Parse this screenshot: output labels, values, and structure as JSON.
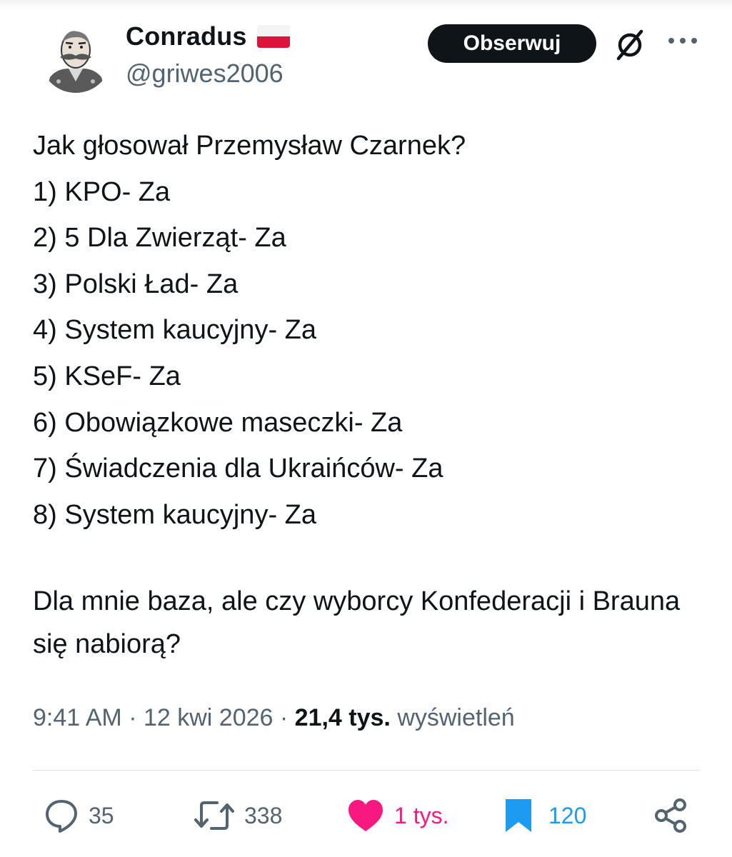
{
  "user": {
    "name": "Conradus",
    "handle": "@griwes2006"
  },
  "header": {
    "follow_label": "Obserwuj"
  },
  "tweet": {
    "lines": [
      "Jak głosował Przemysław Czarnek?",
      "1) KPO- Za",
      "2) 5 Dla Zwierząt- Za",
      "3) Polski Ład- Za",
      "4) System kaucyjny- Za",
      "5) KSeF- Za",
      "6) Obowiązkowe maseczki- Za",
      "7) Świadczenia dla Ukraińców- Za",
      "8) System kaucyjny- Za"
    ],
    "closing": "Dla mnie baza, ale czy wyborcy Konfederacji i Brauna się nabiorą?"
  },
  "meta": {
    "time": "9:41 AM",
    "sep1": " · ",
    "date": "12 kwi 2026",
    "sep2": " · ",
    "views_count": "21,4 tys.",
    "views_label": " wyświetleń"
  },
  "actions": {
    "replies": "35",
    "reposts": "338",
    "likes": "1 tys.",
    "bookmarks": "120"
  },
  "icons": {
    "reply": "reply-bubble-icon",
    "repost": "repost-icon",
    "like": "heart-icon",
    "bookmark": "bookmark-icon",
    "share": "share-icon",
    "grok": "grok-icon",
    "more": "more-dots-icon",
    "flag": "poland-flag-icon"
  },
  "colors": {
    "like": "#f91880",
    "bookmark": "#1d9bf0",
    "secondary_text": "#536471",
    "follow_bg": "#0f1419"
  }
}
